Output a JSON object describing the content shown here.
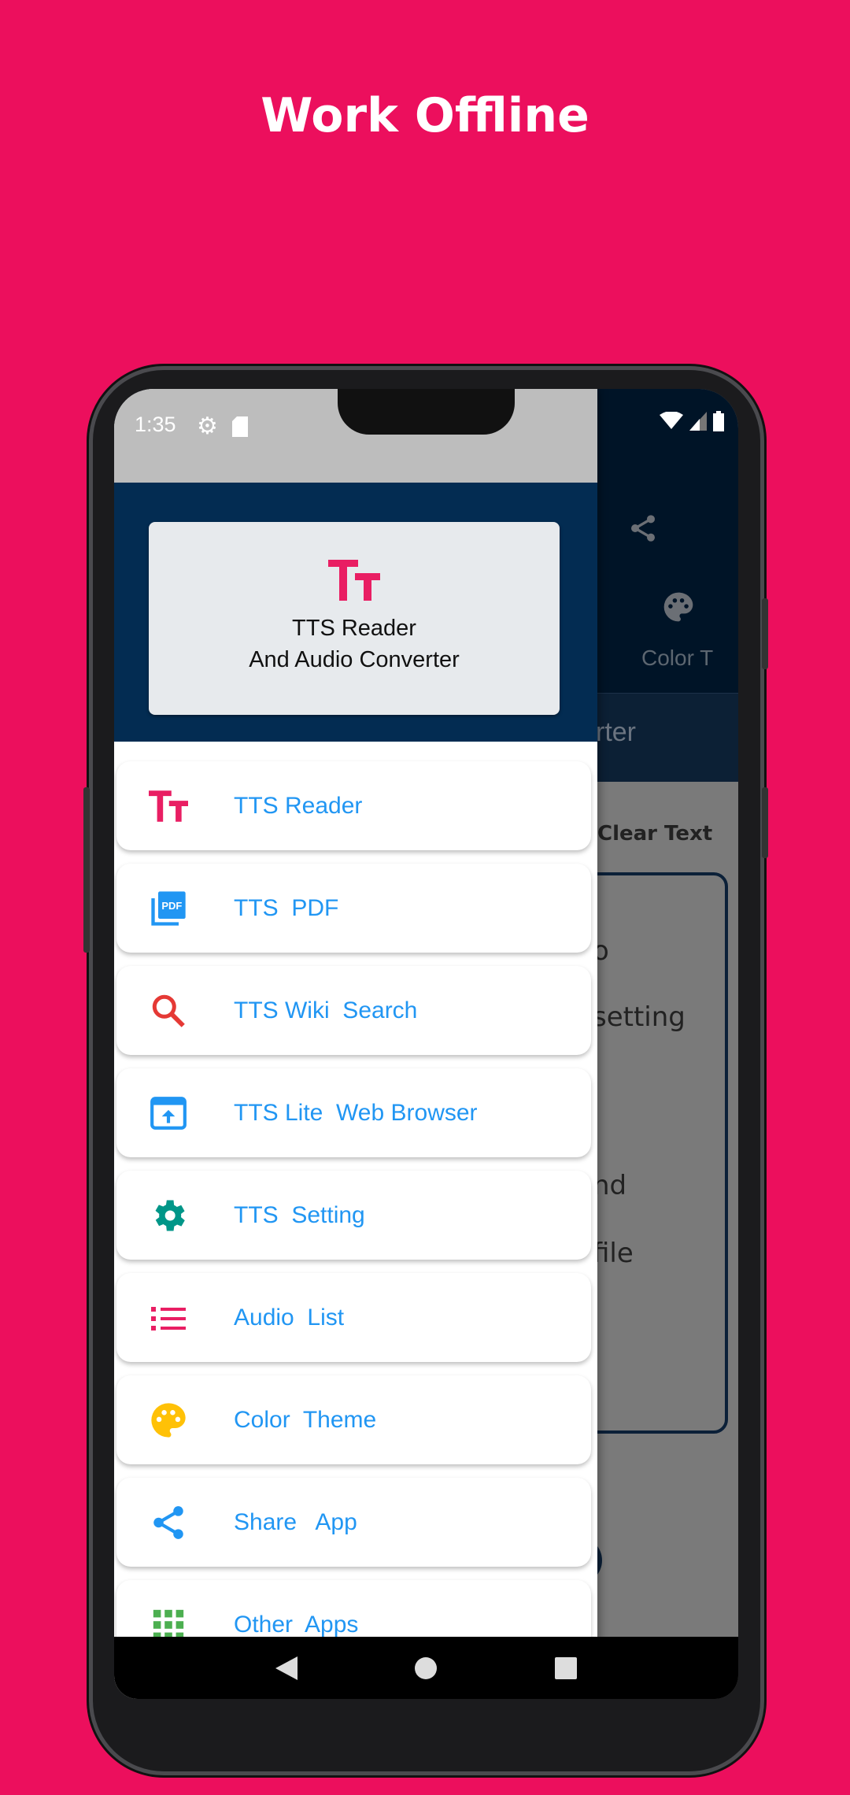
{
  "headline": "Work Offline",
  "status_bar": {
    "time": "1:35"
  },
  "drawer": {
    "header_title_line1": "TTS Reader",
    "header_title_line2": "And Audio Converter",
    "items": [
      {
        "label": "TTS Reader",
        "icon": "tt-logo-icon"
      },
      {
        "label": "TTS  PDF",
        "icon": "pdf-icon"
      },
      {
        "label": "TTS Wiki  Search",
        "icon": "search-icon"
      },
      {
        "label": "TTS Lite  Web Browser",
        "icon": "web-browser-icon"
      },
      {
        "label": "TTS  Setting",
        "icon": "gear-icon"
      },
      {
        "label": "Audio  List",
        "icon": "list-icon"
      },
      {
        "label": "Color  Theme",
        "icon": "palette-icon"
      },
      {
        "label": "Share   App",
        "icon": "share-icon"
      },
      {
        "label": "Other  Apps",
        "icon": "grid-icon"
      }
    ]
  },
  "background_app": {
    "tab_label": "Color T",
    "title_fragment": "rter",
    "clear_text": "Clear Text",
    "fragments": [
      "o",
      "setting",
      "nd",
      "file"
    ]
  },
  "colors": {
    "background": "#ec0f5d",
    "accent": "#e91e63",
    "drawer_header": "#032c52",
    "item_text": "#2196f3"
  }
}
